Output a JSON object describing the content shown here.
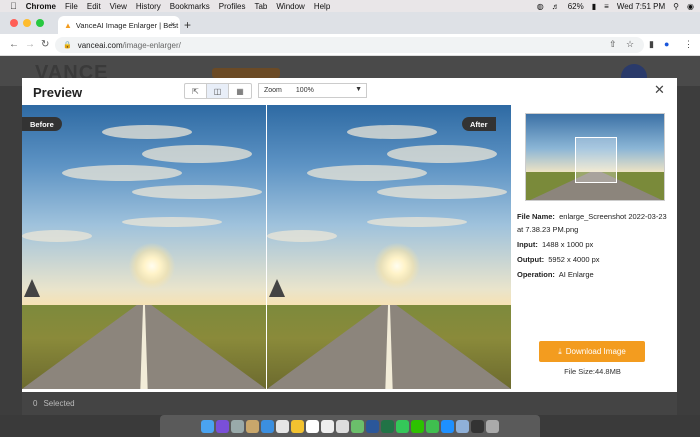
{
  "menubar": {
    "app": "Chrome",
    "items": [
      "File",
      "Edit",
      "View",
      "History",
      "Bookmarks",
      "Profiles",
      "Tab",
      "Window",
      "Help"
    ],
    "battery": "62%",
    "clock": "Wed 7:51 PM"
  },
  "browser": {
    "tab_title": "VanceAI Image Enlarger | Best",
    "url_host": "vanceai.com",
    "url_path": "/image-enlarger/"
  },
  "background": {
    "logo_text": "VANCE",
    "selected_count": "0",
    "selected_label": "Selected"
  },
  "modal": {
    "title": "Preview",
    "zoom_label": "Zoom",
    "zoom_value": "100%",
    "before_label": "Before",
    "after_label": "After",
    "file_name_label": "File Name:",
    "file_name_value": "enlarge_Screenshot 2022-03-23 at 7.38.23 PM.png",
    "input_label": "Input:",
    "input_value": "1488 x 1000 px",
    "output_label": "Output:",
    "output_value": "5952 x 4000 px",
    "operation_label": "Operation:",
    "operation_value": "AI Enlarge",
    "download_label": "Download Image",
    "file_size": "File Size:44.8MB"
  },
  "colors": {
    "accent": "#f39c1f",
    "tag_bg": "#333333"
  },
  "dock_icons": [
    "finder",
    "siri",
    "launchpad",
    "notes",
    "safari",
    "photos",
    "chrome",
    "calendar",
    "reminders",
    "textedit",
    "maps",
    "word",
    "excel",
    "messages",
    "wechat",
    "facetime",
    "appstore",
    "preview",
    "terminal",
    "trash"
  ]
}
